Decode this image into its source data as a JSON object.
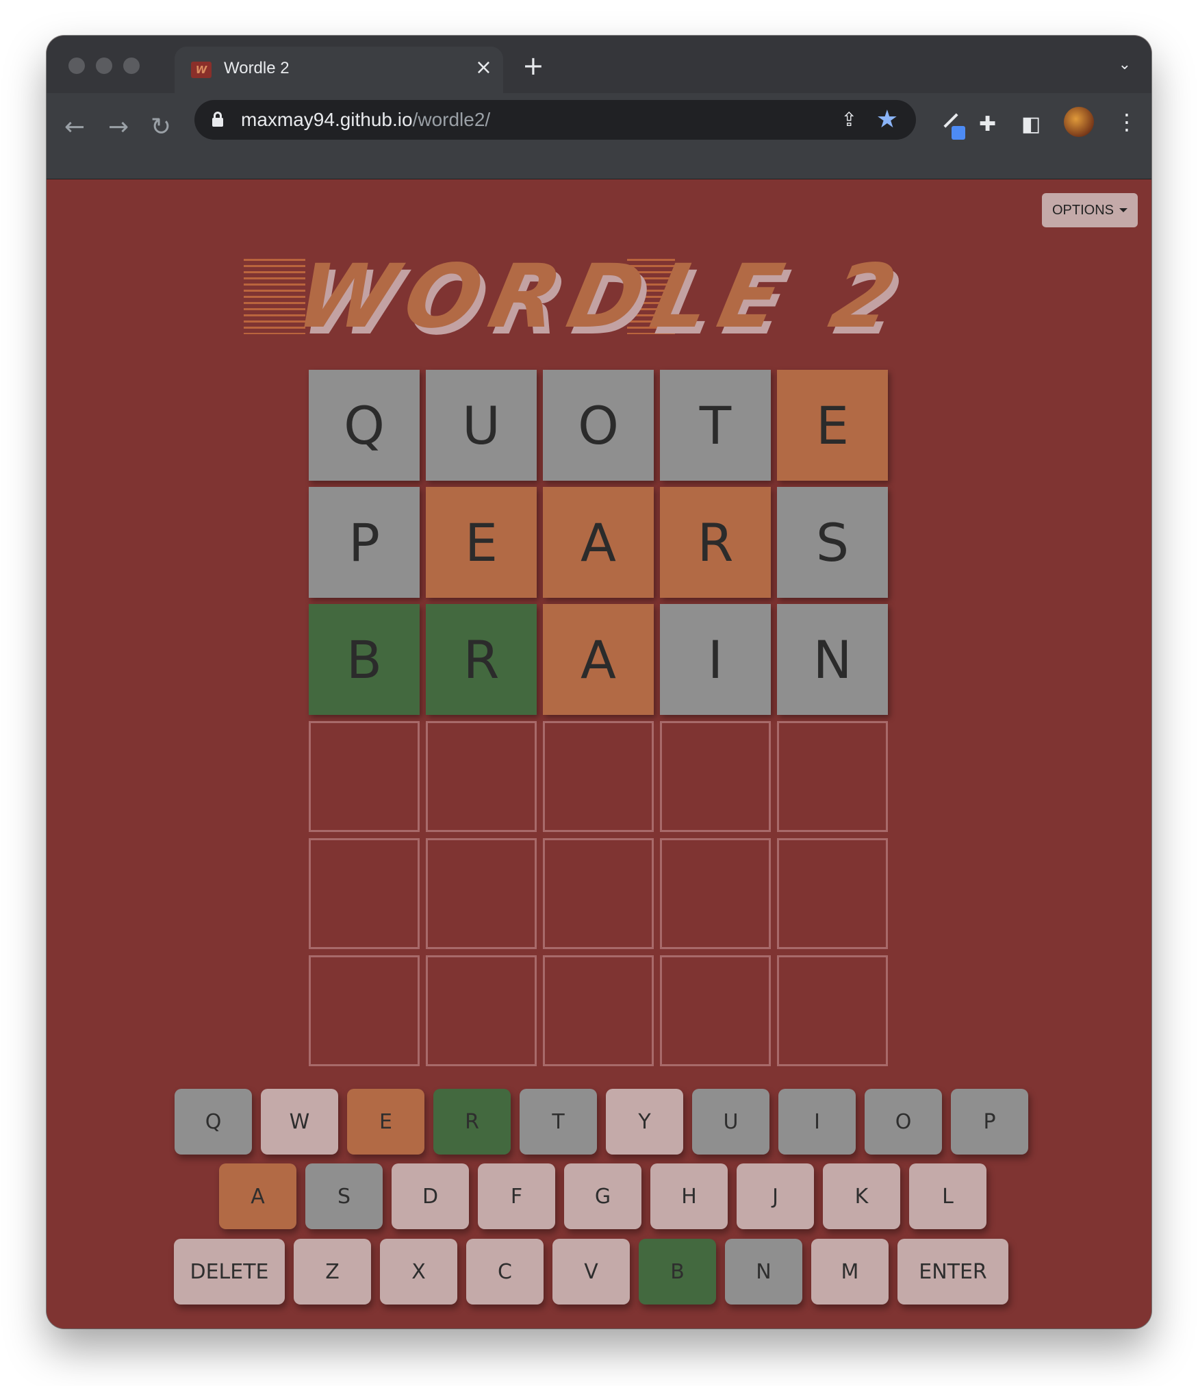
{
  "browser": {
    "tab_title": "Wordle 2",
    "url_host": "maxmay94.github.io",
    "url_path": "/wordle2/"
  },
  "page": {
    "options_label": "OPTIONS",
    "logo_text": "WORDLE 2"
  },
  "colors": {
    "background": "#7f3432",
    "absent": "#8f8f8f",
    "present": "#b26a45",
    "correct": "#43693f",
    "unused_key": "#c4aaa9"
  },
  "board": {
    "rows": [
      [
        {
          "letter": "Q",
          "state": "gray"
        },
        {
          "letter": "U",
          "state": "gray"
        },
        {
          "letter": "O",
          "state": "gray"
        },
        {
          "letter": "T",
          "state": "gray"
        },
        {
          "letter": "E",
          "state": "orange"
        }
      ],
      [
        {
          "letter": "P",
          "state": "gray"
        },
        {
          "letter": "E",
          "state": "orange"
        },
        {
          "letter": "A",
          "state": "orange"
        },
        {
          "letter": "R",
          "state": "orange"
        },
        {
          "letter": "S",
          "state": "gray"
        }
      ],
      [
        {
          "letter": "B",
          "state": "green"
        },
        {
          "letter": "R",
          "state": "green"
        },
        {
          "letter": "A",
          "state": "orange"
        },
        {
          "letter": "I",
          "state": "gray"
        },
        {
          "letter": "N",
          "state": "gray"
        }
      ],
      [
        {
          "letter": "",
          "state": "empty"
        },
        {
          "letter": "",
          "state": "empty"
        },
        {
          "letter": "",
          "state": "empty"
        },
        {
          "letter": "",
          "state": "empty"
        },
        {
          "letter": "",
          "state": "empty"
        }
      ],
      [
        {
          "letter": "",
          "state": "empty"
        },
        {
          "letter": "",
          "state": "empty"
        },
        {
          "letter": "",
          "state": "empty"
        },
        {
          "letter": "",
          "state": "empty"
        },
        {
          "letter": "",
          "state": "empty"
        }
      ],
      [
        {
          "letter": "",
          "state": "empty"
        },
        {
          "letter": "",
          "state": "empty"
        },
        {
          "letter": "",
          "state": "empty"
        },
        {
          "letter": "",
          "state": "empty"
        },
        {
          "letter": "",
          "state": "empty"
        }
      ]
    ]
  },
  "keyboard": {
    "rows": [
      [
        {
          "label": "Q",
          "state": "gray"
        },
        {
          "label": "W",
          "state": "light"
        },
        {
          "label": "E",
          "state": "orange"
        },
        {
          "label": "R",
          "state": "green"
        },
        {
          "label": "T",
          "state": "gray"
        },
        {
          "label": "Y",
          "state": "light"
        },
        {
          "label": "U",
          "state": "gray"
        },
        {
          "label": "I",
          "state": "gray"
        },
        {
          "label": "O",
          "state": "gray"
        },
        {
          "label": "P",
          "state": "gray"
        }
      ],
      [
        {
          "label": "A",
          "state": "orange"
        },
        {
          "label": "S",
          "state": "gray"
        },
        {
          "label": "D",
          "state": "light"
        },
        {
          "label": "F",
          "state": "light"
        },
        {
          "label": "G",
          "state": "light"
        },
        {
          "label": "H",
          "state": "light"
        },
        {
          "label": "J",
          "state": "light"
        },
        {
          "label": "K",
          "state": "light"
        },
        {
          "label": "L",
          "state": "light"
        }
      ],
      [
        {
          "label": "DELETE",
          "state": "light",
          "wide": true
        },
        {
          "label": "Z",
          "state": "light"
        },
        {
          "label": "X",
          "state": "light"
        },
        {
          "label": "C",
          "state": "light"
        },
        {
          "label": "V",
          "state": "light"
        },
        {
          "label": "B",
          "state": "green"
        },
        {
          "label": "N",
          "state": "gray"
        },
        {
          "label": "M",
          "state": "light"
        },
        {
          "label": "ENTER",
          "state": "light",
          "wide": true
        }
      ]
    ]
  }
}
